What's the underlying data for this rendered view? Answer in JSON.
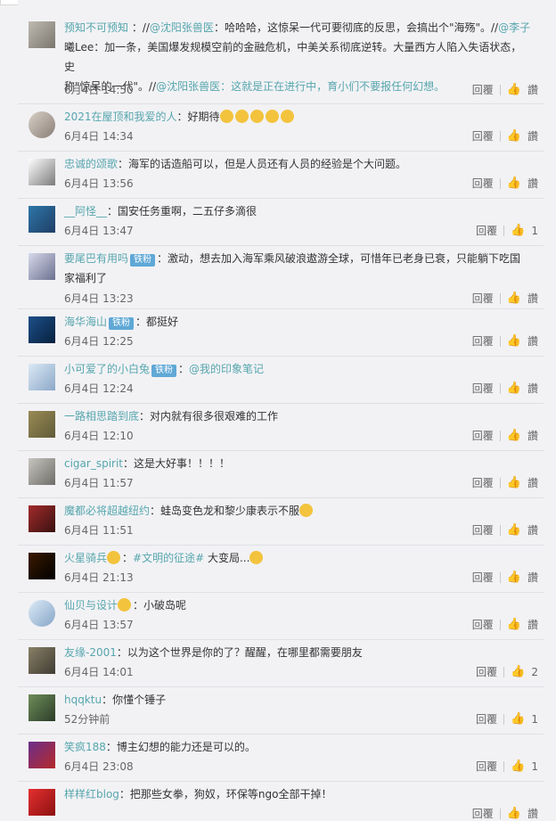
{
  "comments": [
    {
      "user": "预知不可预知",
      "mid": " ：//",
      "lines": [
        [
          "@沈阳张兽医",
          "：哈哈哈，这惊呆一代可要彻底的反思，会搞出个\"海殇\"。//"
        ],
        [
          "@李子",
          "曦Lee：加一条，美国爆发规模空前的金融危机，中美关系彻底逆转。大量西方人陷入失语状态，史"
        ],
        [
          "称\"惊呆的一代\"。//",
          "@沈阳张兽医：这就是正在进行中，育小们不要报任何幻想。"
        ]
      ],
      "time": "6月4日 14:50",
      "reply": "回覆",
      "like": "讚"
    },
    {
      "user": "2021在屋顶和我爱的人",
      "text": "：好期待",
      "time": "6月4日 14:34",
      "reply": "回覆",
      "like": "讚"
    },
    {
      "user": "忠诚的颂歌",
      "text": "：海军的话造船可以，但是人员还有人员的经验是个大问题。",
      "time": "6月4日 13:56",
      "reply": "回覆",
      "like": "讚"
    },
    {
      "user": "__阿怪__",
      "text": "：国安任务重啊，二五仔多滴很",
      "time": "6月4日 13:47",
      "reply": "回覆",
      "like": "1"
    },
    {
      "user": "要尾巴有用吗",
      "badge": "铁粉",
      "text": "：激动，想去加入海军乘风破浪遨游全球，可惜年已老身已衰，只能躺下吃国",
      "text2": "家福利了",
      "time": "6月4日 13:23",
      "reply": "回覆",
      "like": "讚"
    },
    {
      "user": "海华海山",
      "badge": "铁粉",
      "text": "：都挺好",
      "time": "6月4日 12:25",
      "reply": "回覆",
      "like": "讚"
    },
    {
      "user": "小可爱了的小白兔",
      "badge": "铁粉",
      "text": "：",
      "mention": "@我的印象笔记",
      "time": "6月4日 12:24",
      "reply": "回覆",
      "like": "讚"
    },
    {
      "user": "一路相思踏到底",
      "text": "：对内就有很多很艰难的工作",
      "time": "6月4日 12:10",
      "reply": "回覆",
      "like": "讚"
    },
    {
      "user": "cigar_spirit",
      "text": "：这是大好事！！！！",
      "time": "6月4日 11:57",
      "reply": "回覆",
      "like": "讚"
    },
    {
      "user": "魔都必将超越纽约",
      "text": "：蛙岛变色龙和黎少康表示不服",
      "time": "6月4日 11:51",
      "reply": "回覆",
      "like": "讚"
    },
    {
      "user": "火星骑兵",
      "tag": "#文明的征途#",
      "text": " 大变局...",
      "time": "6月4日 21:13",
      "reply": "回覆",
      "like": "讚"
    },
    {
      "user": "仙贝与设计",
      "text": "：小破岛呢",
      "time": "6月4日 13:57",
      "reply": "回覆",
      "like": "讚"
    },
    {
      "user": "友缘-2001",
      "text": "：以为这个世界是你的了？醒醒，在哪里都需要朋友",
      "time": "6月4日 14:01",
      "reply": "回覆",
      "like": "2"
    },
    {
      "user": "hqqktu",
      "text": "：你懂个锤子",
      "time": "52分钟前",
      "reply": "回覆",
      "like": "1"
    },
    {
      "user": "笑疯188",
      "text": "：博主幻想的能力还是可以的。",
      "time": "6月4日 23:08",
      "reply": "回覆",
      "like": "1"
    },
    {
      "user": "样样红blog",
      "text": "：把那些女拳，狗奴，环保等ngo全部干掉！",
      "time": "",
      "reply": "回覆",
      "like": "讚"
    }
  ]
}
